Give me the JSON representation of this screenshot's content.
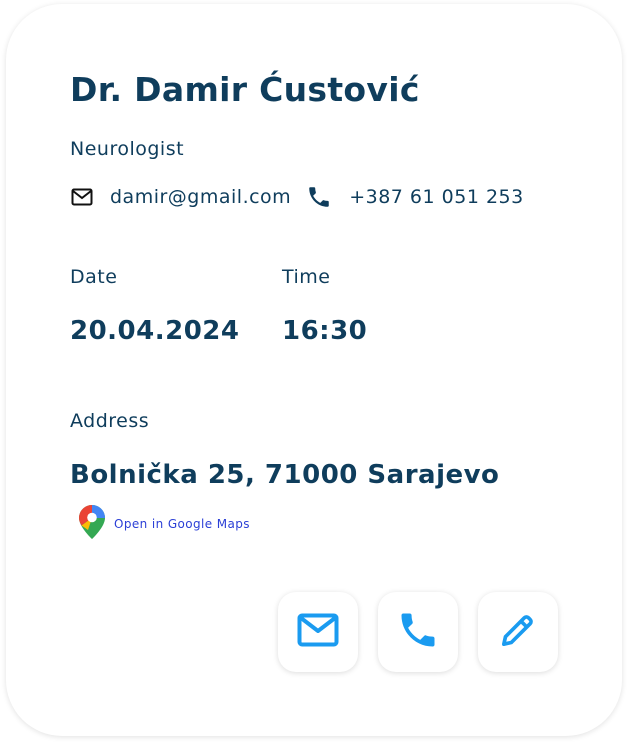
{
  "doctor": {
    "name": "Dr. Damir Ćustović",
    "specialty": "Neurologist",
    "email": "damir@gmail.com",
    "phone": "+387 61 051 253"
  },
  "appointment": {
    "date_label": "Date",
    "date_value": "20.04.2024",
    "time_label": "Time",
    "time_value": "16:30"
  },
  "address": {
    "label": "Address",
    "value": "Bolnička 25, 71000 Sarajevo",
    "maps_link_text": "Open in Google Maps"
  },
  "actions": [
    {
      "icon": "mail-icon",
      "kind": "email"
    },
    {
      "icon": "phone-icon",
      "kind": "call"
    },
    {
      "icon": "pencil-icon",
      "kind": "edit"
    }
  ],
  "colors": {
    "text_primary": "#0f3d5c",
    "action_blue": "#1a9bf0",
    "link_blue": "#2b3fd6"
  },
  "icons": {
    "email": "mail-icon",
    "phone": "phone-icon",
    "maps": "map-pin-icon"
  }
}
